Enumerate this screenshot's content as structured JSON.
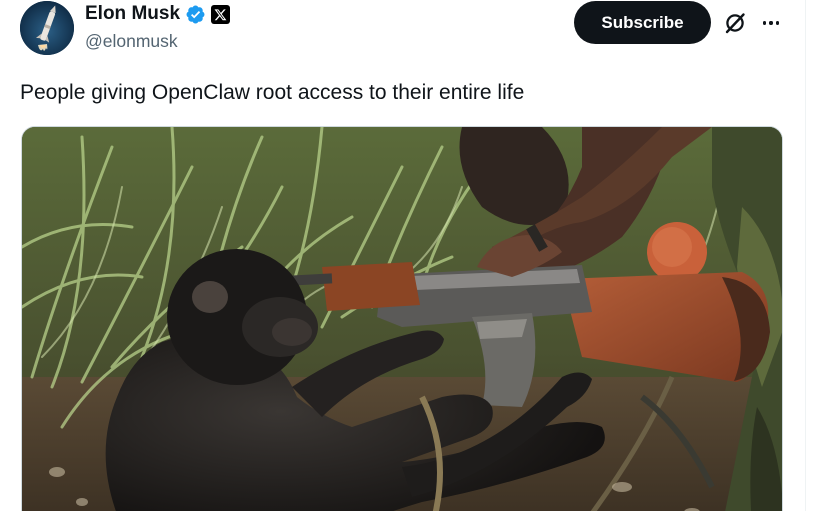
{
  "author": {
    "name": "Elon Musk",
    "handle": "@elonmusk",
    "verified_icon": "verified-badge-icon",
    "affiliation_icon": "x-logo-icon",
    "avatar_icon": "rocket-avatar"
  },
  "actions": {
    "subscribe_label": "Subscribe",
    "grok_icon": "grok-icon",
    "more_icon": "more-horizontal-icon"
  },
  "post": {
    "text": "People giving OpenClaw root access to their entire life"
  },
  "colors": {
    "accent_verified": "#1d9bf0",
    "text_primary": "#0f1419",
    "text_secondary": "#536471",
    "button_bg": "#0f1419",
    "button_text": "#ffffff"
  }
}
